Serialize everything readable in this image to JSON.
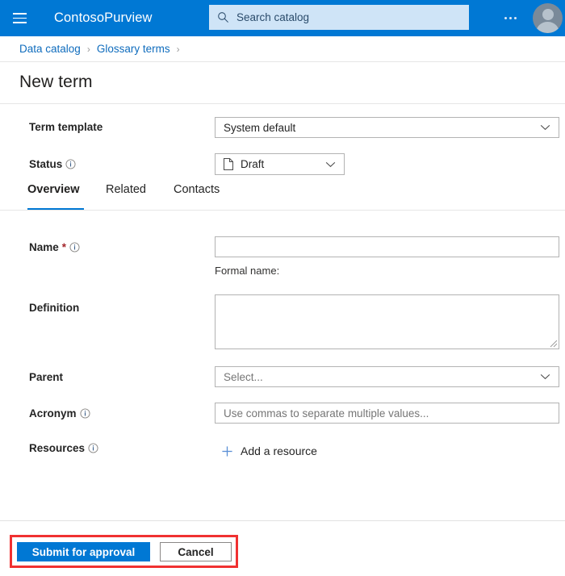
{
  "topbar": {
    "menu_icon": "hamburger-menu-icon",
    "brand": "ContosoPurview",
    "search": {
      "icon": "search-icon",
      "placeholder": "Search catalog",
      "value": ""
    },
    "overflow_icon": "more-options-icon",
    "account_icon": "user-avatar-icon",
    "background_color": "#0078d4",
    "search_background_color": "#cfe4f7"
  },
  "breadcrumb": {
    "items": [
      {
        "label": "Data catalog"
      },
      {
        "label": "Glossary terms"
      }
    ],
    "separator": "›",
    "link_color": "#0f6cbd"
  },
  "page": {
    "title": "New term"
  },
  "form": {
    "term_template": {
      "label": "Term template",
      "value": "System default",
      "chevron_icon": "chevron-down-icon"
    },
    "status": {
      "label": "Status",
      "info_icon": "info-icon",
      "value": "Draft",
      "value_icon": "page-document-icon",
      "chevron_icon": "chevron-down-icon"
    },
    "name": {
      "label": "Name",
      "required_marker": "*",
      "info_icon": "info-icon",
      "value": "",
      "placeholder": "",
      "helper": "Formal name:"
    },
    "definition": {
      "label": "Definition",
      "value": "",
      "placeholder": ""
    },
    "parent": {
      "label": "Parent",
      "placeholder": "Select...",
      "value": "",
      "chevron_icon": "chevron-down-icon"
    },
    "acronym": {
      "label": "Acronym",
      "info_icon": "info-icon",
      "placeholder": "Use commas to separate multiple values...",
      "value": ""
    },
    "resources": {
      "label": "Resources",
      "info_icon": "info-icon",
      "add_label": "Add a resource",
      "add_icon": "plus-icon",
      "add_icon_color": "#5a8fd6"
    }
  },
  "tabs": {
    "items": [
      {
        "label": "Overview",
        "active": true
      },
      {
        "label": "Related",
        "active": false
      },
      {
        "label": "Contacts",
        "active": false
      }
    ],
    "active_indicator_color": "#0078d4"
  },
  "footer": {
    "submit_label": "Submit for approval",
    "cancel_label": "Cancel",
    "primary_color": "#0078d4",
    "highlight_color": "#f03131"
  }
}
